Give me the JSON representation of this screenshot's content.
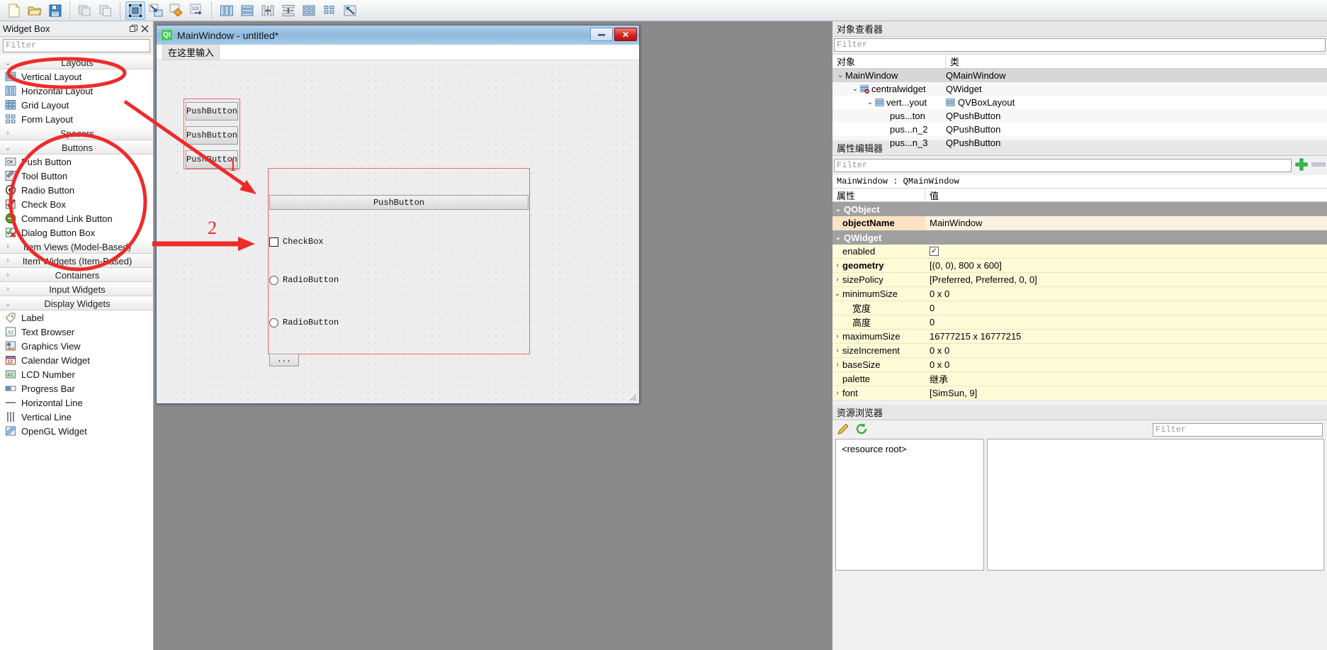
{
  "toolbar": {
    "buttons": [
      {
        "name": "new-form-button",
        "icon": "document-icon"
      },
      {
        "name": "open-form-button",
        "icon": "folder-icon"
      },
      {
        "name": "save-form-button",
        "icon": "floppy-disk-icon"
      },
      {
        "name": "copy-button",
        "icon": "copy-icon"
      },
      {
        "name": "paste-button",
        "icon": "paste-icon"
      },
      {
        "name": "edit-widgets-button",
        "icon": "edit-widgets-icon"
      },
      {
        "name": "edit-signals-slots-button",
        "icon": "signals-slots-icon"
      },
      {
        "name": "edit-buddies-button",
        "icon": "buddies-icon"
      },
      {
        "name": "edit-tab-order-button",
        "icon": "tab-order-icon"
      },
      {
        "name": "layout-horizontally-button",
        "icon": "layout-horizontal-icon"
      },
      {
        "name": "layout-vertically-button",
        "icon": "layout-vertical-icon"
      },
      {
        "name": "layout-splitter-horizontal-button",
        "icon": "splitter-horizontal-icon"
      },
      {
        "name": "layout-splitter-vertical-button",
        "icon": "splitter-vertical-icon"
      },
      {
        "name": "layout-grid-button",
        "icon": "layout-grid-icon"
      },
      {
        "name": "layout-form-button",
        "icon": "layout-form-icon"
      },
      {
        "name": "break-layout-button",
        "icon": "break-layout-icon"
      }
    ]
  },
  "widget_box": {
    "title": "Widget Box",
    "float_icon": "float-dock-icon",
    "close_icon": "close-icon",
    "filter_placeholder": "Filter",
    "groups": [
      {
        "name": "Layouts",
        "expanded": true,
        "chevron": "⌄",
        "items": [
          {
            "label": "Vertical Layout",
            "icon": "vertical-layout-icon"
          },
          {
            "label": "Horizontal Layout",
            "icon": "horizontal-layout-icon"
          },
          {
            "label": "Grid Layout",
            "icon": "grid-layout-icon"
          },
          {
            "label": "Form Layout",
            "icon": "form-layout-icon"
          }
        ]
      },
      {
        "name": "Spacers",
        "expanded": false,
        "chevron": "›",
        "items": []
      },
      {
        "name": "Buttons",
        "expanded": true,
        "chevron": "⌄",
        "items": [
          {
            "label": "Push Button",
            "icon": "push-button-icon"
          },
          {
            "label": "Tool Button",
            "icon": "tool-button-icon"
          },
          {
            "label": "Radio Button",
            "icon": "radio-button-icon"
          },
          {
            "label": "Check Box",
            "icon": "check-box-icon"
          },
          {
            "label": "Command Link Button",
            "icon": "command-link-icon"
          },
          {
            "label": "Dialog Button Box",
            "icon": "dialog-button-box-icon"
          }
        ]
      },
      {
        "name": "Item Views (Model-Based)",
        "expanded": false,
        "chevron": "›",
        "items": []
      },
      {
        "name": "Item Widgets (Item-Based)",
        "expanded": false,
        "chevron": "›",
        "items": []
      },
      {
        "name": "Containers",
        "expanded": false,
        "chevron": "›",
        "items": []
      },
      {
        "name": "Input Widgets",
        "expanded": false,
        "chevron": "›",
        "items": []
      },
      {
        "name": "Display Widgets",
        "expanded": true,
        "chevron": "⌄",
        "items": [
          {
            "label": "Label",
            "icon": "label-icon"
          },
          {
            "label": "Text Browser",
            "icon": "text-browser-icon"
          },
          {
            "label": "Graphics View",
            "icon": "graphics-view-icon"
          },
          {
            "label": "Calendar Widget",
            "icon": "calendar-icon"
          },
          {
            "label": "LCD Number",
            "icon": "lcd-number-icon"
          },
          {
            "label": "Progress Bar",
            "icon": "progress-bar-icon"
          },
          {
            "label": "Horizontal Line",
            "icon": "horizontal-line-icon"
          },
          {
            "label": "Vertical Line",
            "icon": "vertical-line-icon"
          },
          {
            "label": "OpenGL Widget",
            "icon": "opengl-widget-icon"
          }
        ]
      }
    ]
  },
  "form": {
    "title": "MainWindow - untitled*",
    "logo_text": "Qt",
    "minimize_label": "—",
    "close_label": "✕",
    "menu_placeholder": "在这里输入",
    "vertical_layout_buttons": [
      "PushButton",
      "PushButton",
      "PushButton"
    ],
    "wide_button": "PushButton",
    "checkbox_label": "CheckBox",
    "radio1_label": "RadioButton",
    "radio2_label": "RadioButton",
    "tool_button_label": "..."
  },
  "annotations": {
    "marker1": "1",
    "marker2": "2",
    "color": "#ee2b2b"
  },
  "object_inspector": {
    "title": "对象查看器",
    "filter_placeholder": "Filter",
    "columns": [
      "对象",
      "类"
    ],
    "rows": [
      {
        "name": "MainWindow",
        "class": "QMainWindow",
        "indent": 0,
        "chevron": "⌄",
        "icon": "",
        "selected": true
      },
      {
        "name": "centralwidget",
        "class": "QWidget",
        "indent": 1,
        "chevron": "⌄",
        "icon": "central-widget-icon",
        "selected": false
      },
      {
        "name": "vert...yout",
        "class": "QVBoxLayout",
        "indent": 2,
        "chevron": "⌄",
        "icon": "vertical-layout-icon",
        "class_icon": "vertical-layout-icon",
        "selected": false
      },
      {
        "name": "pus...ton",
        "class": "QPushButton",
        "indent": 3,
        "chevron": "",
        "icon": "",
        "selected": false
      },
      {
        "name": "pus...n_2",
        "class": "QPushButton",
        "indent": 3,
        "chevron": "",
        "icon": "",
        "selected": false
      },
      {
        "name": "pus...n_3",
        "class": "QPushButton",
        "indent": 3,
        "chevron": "",
        "icon": "",
        "selected": false
      }
    ]
  },
  "property_editor": {
    "title": "属性编辑器",
    "filter_placeholder": "Filter",
    "add_icon": "plus-icon",
    "remove_icon": "minus-icon",
    "selected_object": "MainWindow : QMainWindow",
    "columns": [
      "属性",
      "值"
    ],
    "rows": [
      {
        "type": "group",
        "key": "QObject",
        "value": "",
        "chevron": "⌄"
      },
      {
        "type": "prop",
        "key": "objectName",
        "value": "MainWindow",
        "chevron": "",
        "bold": true,
        "highlight": "orange",
        "indent": 1
      },
      {
        "type": "group",
        "key": "QWidget",
        "value": "",
        "chevron": "⌄"
      },
      {
        "type": "prop",
        "key": "enabled",
        "value": "",
        "chevron": "",
        "checkbox": true,
        "indent": 1
      },
      {
        "type": "prop",
        "key": "geometry",
        "value": "[(0, 0), 800 x 600]",
        "chevron": "›",
        "bold": true,
        "indent": 0
      },
      {
        "type": "prop",
        "key": "sizePolicy",
        "value": "[Preferred, Preferred, 0, 0]",
        "chevron": "›",
        "indent": 0
      },
      {
        "type": "prop",
        "key": "minimumSize",
        "value": "0 x 0",
        "chevron": "⌄",
        "indent": 0
      },
      {
        "type": "prop",
        "key": "宽度",
        "value": "0",
        "chevron": "",
        "indent": 2
      },
      {
        "type": "prop",
        "key": "高度",
        "value": "0",
        "chevron": "",
        "indent": 2
      },
      {
        "type": "prop",
        "key": "maximumSize",
        "value": "16777215 x 16777215",
        "chevron": "›",
        "indent": 0
      },
      {
        "type": "prop",
        "key": "sizeIncrement",
        "value": "0 x 0",
        "chevron": "›",
        "indent": 0
      },
      {
        "type": "prop",
        "key": "baseSize",
        "value": "0 x 0",
        "chevron": "›",
        "indent": 0
      },
      {
        "type": "prop",
        "key": "palette",
        "value": "继承",
        "chevron": "",
        "indent": 1
      },
      {
        "type": "prop",
        "key": "font",
        "value": "[SimSun, 9]",
        "chevron": "›",
        "indent": 0
      }
    ]
  },
  "resource_browser": {
    "title": "资源浏览器",
    "edit_icon": "pencil-icon",
    "reload_icon": "reload-icon",
    "filter_placeholder": "Filter",
    "root_label": "<resource root>"
  }
}
